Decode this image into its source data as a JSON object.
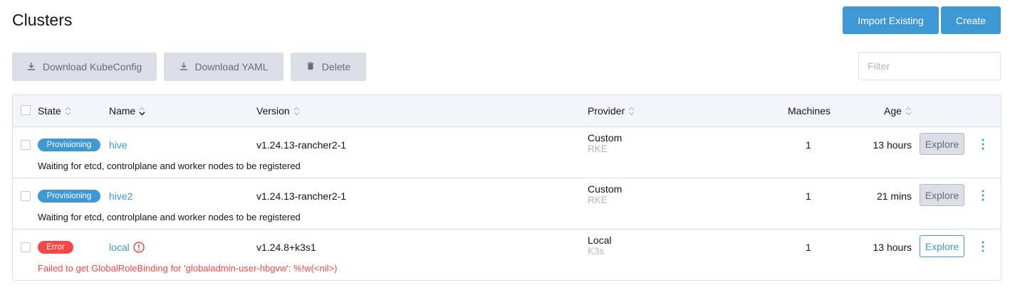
{
  "header": {
    "title": "Clusters",
    "import_label": "Import Existing",
    "create_label": "Create"
  },
  "bulk_actions": {
    "download_kubeconfig": "Download KubeConfig",
    "download_yaml": "Download YAML",
    "delete": "Delete"
  },
  "filter": {
    "placeholder": "Filter",
    "value": ""
  },
  "table": {
    "columns": {
      "state": "State",
      "name": "Name",
      "version": "Version",
      "provider": "Provider",
      "machines": "Machines",
      "age": "Age"
    },
    "rows": [
      {
        "state": "Provisioning",
        "name": "hive",
        "version": "v1.24.13-rancher2-1",
        "provider": "Custom",
        "provider_sub": "RKE",
        "machines": "1",
        "age": "13 hours",
        "explore": "Explore",
        "description": "Waiting for etcd, controlplane and worker nodes to be registered"
      },
      {
        "state": "Provisioning",
        "name": "hive2",
        "version": "v1.24.13-rancher2-1",
        "provider": "Custom",
        "provider_sub": "RKE",
        "machines": "1",
        "age": "21 mins",
        "explore": "Explore",
        "description": "Waiting for etcd, controlplane and worker nodes to be registered"
      },
      {
        "state": "Error",
        "name": "local",
        "version": "v1.24.8+k3s1",
        "provider": "Local",
        "provider_sub": "K3s",
        "machines": "1",
        "age": "13 hours",
        "explore": "Explore",
        "description": "Failed to get GlobalRoleBinding for 'globaladmin-user-hbgvw': %!w(<nil>)"
      }
    ]
  },
  "colors": {
    "primary": "#3d98d3",
    "error": "#f64747",
    "muted": "#b6b6c2"
  }
}
